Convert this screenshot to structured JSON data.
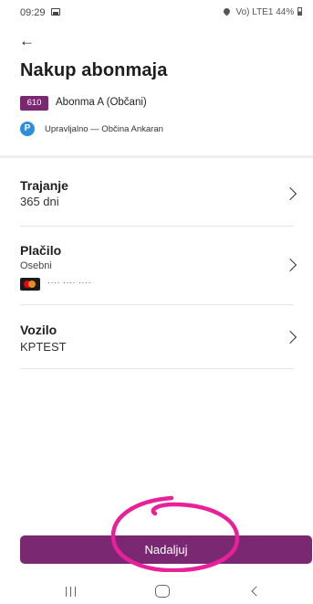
{
  "status_bar": {
    "time": "09:29",
    "indicators": "Vo) LTE1",
    "battery": "44%",
    "icons": [
      "gallery-icon",
      "location-icon",
      "wifi-icon",
      "signal-icon",
      "battery-icon"
    ]
  },
  "header": {
    "back_icon": "arrow-left-icon",
    "title": "Nakup abonmaja"
  },
  "zone": {
    "code": "610",
    "name": "Abonma A (Občani)",
    "badge_color": "#7b2873"
  },
  "operator": {
    "icon": "parking-icon",
    "icon_label": "P",
    "text": "Upravljalno — Občina Ankaran",
    "icon_color": "#2d8ed9"
  },
  "rows": {
    "duration": {
      "title": "Trajanje",
      "value": "365 dni"
    },
    "payment": {
      "title": "Plačilo",
      "subtitle": "Osebni",
      "card_number": "···· ···· ····"
    },
    "vehicle": {
      "title": "Vozilo",
      "value": "KPTEST"
    }
  },
  "actions": {
    "continue_label": "Nadaljuj",
    "button_color": "#7b2873",
    "highlight_color": "#e8209a"
  },
  "nav_bar": {
    "icons": [
      "recents-icon",
      "home-icon",
      "back-icon"
    ]
  }
}
